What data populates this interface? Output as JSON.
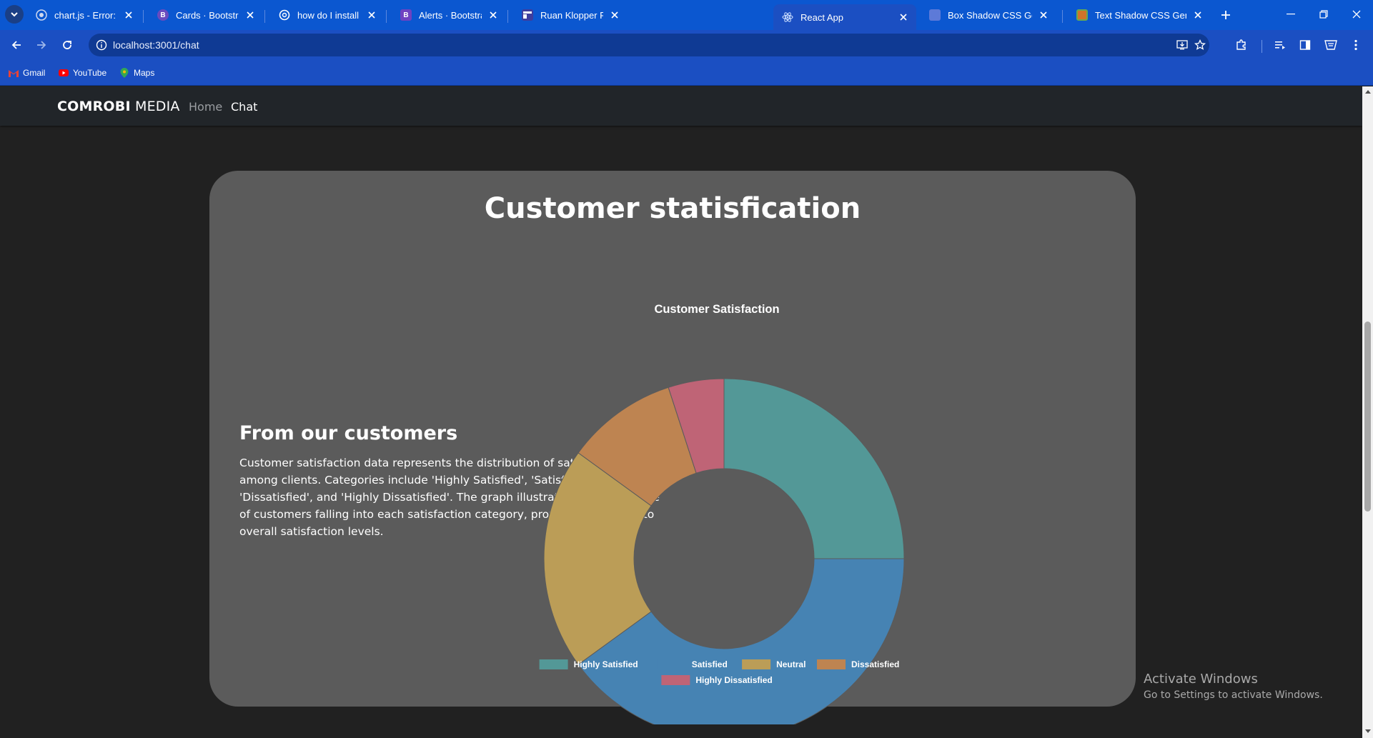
{
  "browser": {
    "tabs": [
      {
        "title": "chart.js - Error: \"category\"",
        "favicon": "github-icon",
        "active": false
      },
      {
        "title": "Cards · Bootstrap",
        "favicon": "bootstrap-icon",
        "active": false
      },
      {
        "title": "how do I install react rout",
        "favicon": "chatgpt-icon",
        "active": false
      },
      {
        "title": "Alerts · Bootstrap",
        "favicon": "bootstrap-icon",
        "active": false
      },
      {
        "title": "Ruan Klopper Photograph",
        "favicon": "page-icon",
        "active": false
      },
      {
        "title": "React App",
        "favicon": "react-icon",
        "active": true
      },
      {
        "title": "Box Shadow CSS Generat",
        "favicon": "page-icon",
        "active": false
      },
      {
        "title": "Text Shadow CSS Generat",
        "favicon": "page-icon",
        "active": false
      }
    ],
    "url": "localhost:3001/chat",
    "bookmarks": [
      {
        "label": "Gmail",
        "icon": "gmail-icon"
      },
      {
        "label": "YouTube",
        "icon": "youtube-icon"
      },
      {
        "label": "Maps",
        "icon": "maps-icon"
      }
    ],
    "accent": "#0b57d0"
  },
  "navbar": {
    "brand_bold": "COMROBI",
    "brand_rest": " MEDIA",
    "links": [
      "Home",
      "Chat"
    ],
    "active_link": "Chat"
  },
  "section": {
    "title": "Customer statisfication",
    "subheading": "From our customers",
    "paragraph": "Customer satisfaction data represents the distribution of satisfaction levels among clients. Categories include 'Highly Satisfied', 'Satisfied', 'Neutral', 'Dissatisfied', and 'Highly Dissatisfied'. The graph illustrates the percentage of customers falling into each satisfaction category, providing insights into overall satisfaction levels."
  },
  "chart_data": {
    "type": "doughnut",
    "title": "Customer Satisfaction",
    "categories": [
      "Highly Satisfied",
      "Satisfied",
      "Neutral",
      "Dissatisfied",
      "Highly Dissatisfied"
    ],
    "values": [
      25,
      40,
      20,
      10,
      5
    ],
    "colors": [
      "#539897",
      "#4683b3",
      "#bb9d57",
      "#be8451",
      "#bf6476"
    ],
    "legend_position": "bottom"
  },
  "os_watermark": {
    "line1": "Activate Windows",
    "line2": "Go to Settings to activate Windows."
  }
}
